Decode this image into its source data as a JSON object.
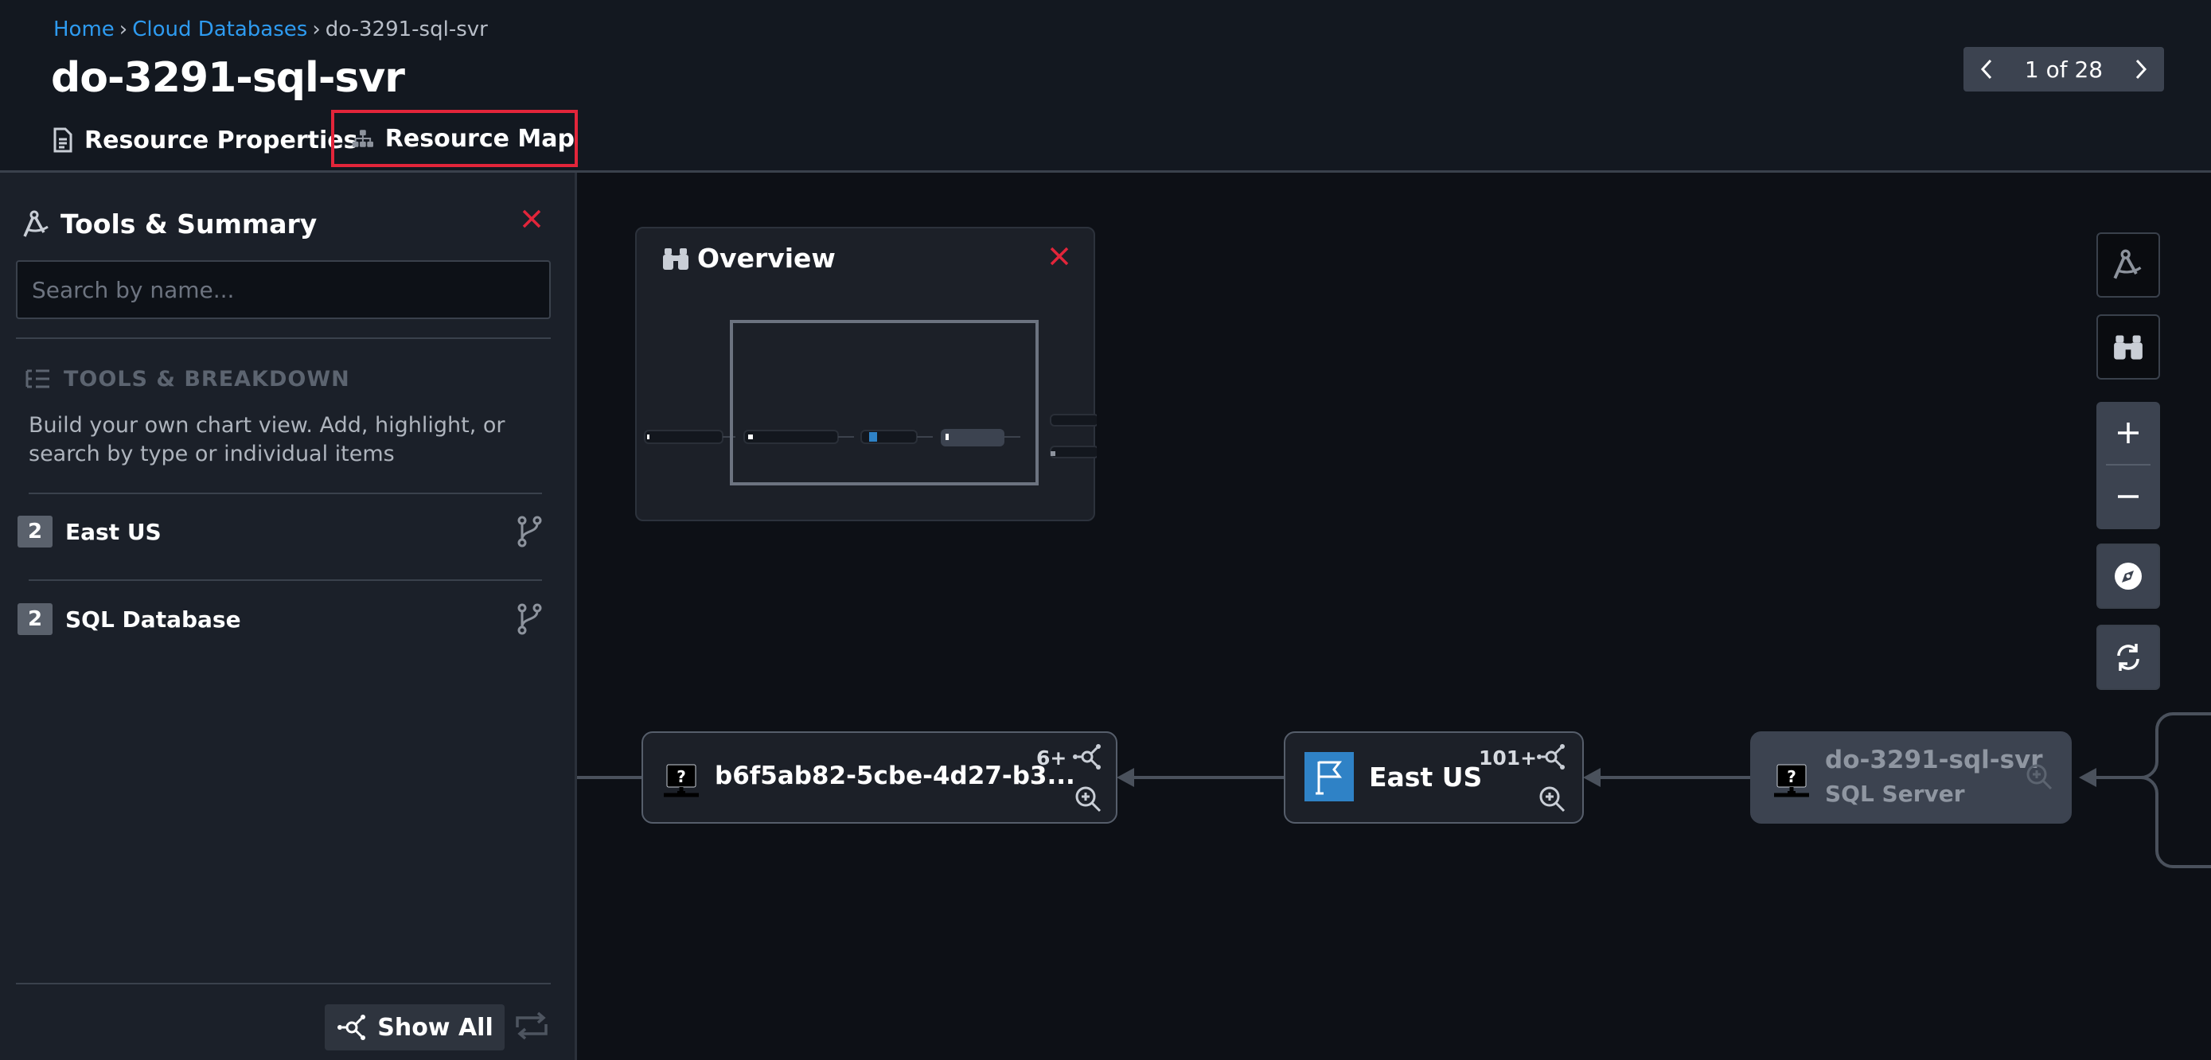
{
  "breadcrumb": {
    "home": "Home",
    "sep1": "›",
    "section": "Cloud Databases",
    "sep2": "›",
    "current": "do-3291-sql-svr"
  },
  "title": "do-3291-sql-svr",
  "tabs": {
    "properties": "Resource Properties",
    "map": "Resource Map",
    "active": "map"
  },
  "pager": {
    "text": "1 of 28"
  },
  "panel": {
    "title": "Tools & Summary",
    "search_placeholder": "Search by name...",
    "section_heading": "TOOLS & BREAKDOWN",
    "description": "Build your own chart view. Add, highlight, or search by type or individual items",
    "items": [
      {
        "count": "2",
        "label": "East US"
      },
      {
        "count": "2",
        "label": "SQL Database"
      }
    ],
    "show_all": "Show All"
  },
  "overview": {
    "title": "Overview"
  },
  "nodes": [
    {
      "label": "b6f5ab82-5cbe-4d27-b3...",
      "count": "6+",
      "icon": "unknown-resource-icon"
    },
    {
      "label": "East US",
      "count": "101+",
      "icon": "region-flag-icon"
    },
    {
      "label": "do-3291-sql-svr",
      "sublabel": "SQL Server",
      "icon": "unknown-resource-icon"
    }
  ],
  "colors": {
    "accent_link": "#2e9bf0",
    "highlight_red": "#e2253a",
    "flag_blue": "#2f82c6"
  }
}
